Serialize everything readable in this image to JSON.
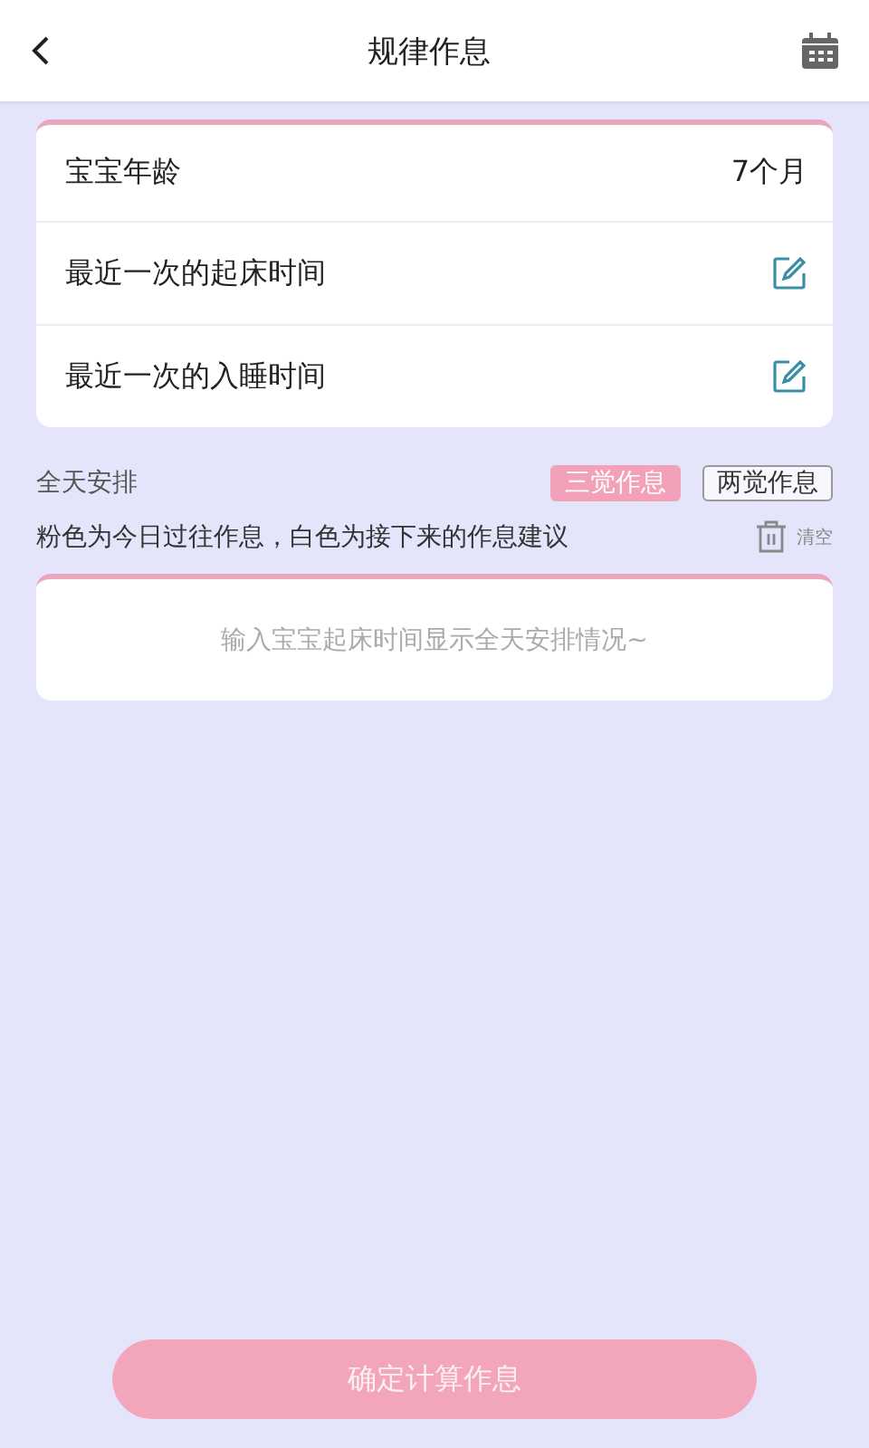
{
  "header": {
    "title": "规律作息"
  },
  "info_rows": [
    {
      "kind": "value",
      "label": "宝宝年龄",
      "value": "7个月"
    },
    {
      "kind": "edit",
      "label": "最近一次的起床时间"
    },
    {
      "kind": "edit",
      "label": "最近一次的入睡时间"
    }
  ],
  "schedule": {
    "title": "全天安排",
    "modes": [
      {
        "label": "三觉作息",
        "selected": true
      },
      {
        "label": "两觉作息",
        "selected": false
      }
    ],
    "hint": "粉色为今日过往作息，白色为接下来的作息建议",
    "clear": "清空",
    "empty_text": "输入宝宝起床时间显示全天安排情况~"
  },
  "confirm_button": "确定计算作息"
}
